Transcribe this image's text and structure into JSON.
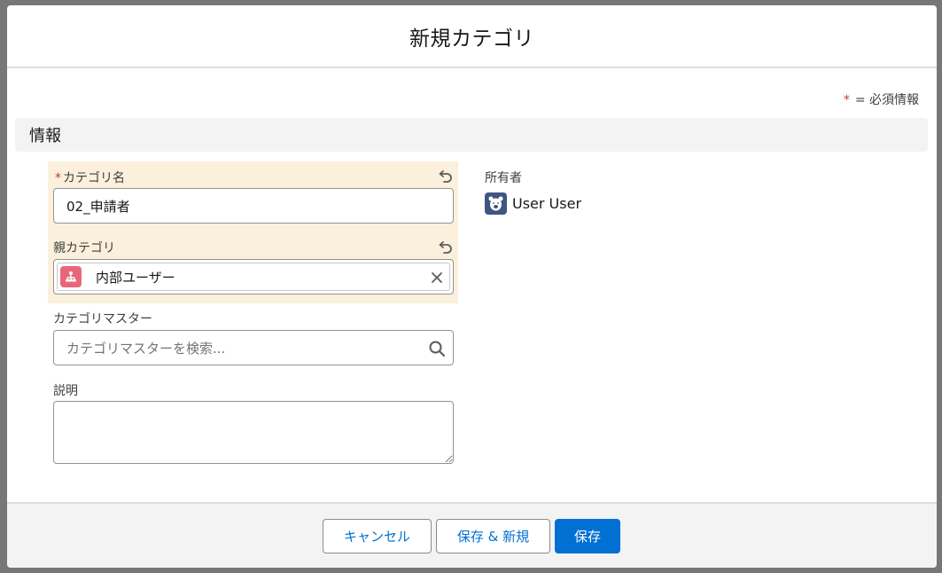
{
  "modal": {
    "title": "新規カテゴリ",
    "required_legend_star": "*",
    "required_legend_text": "= 必須情報"
  },
  "section": {
    "title": "情報"
  },
  "fields": {
    "category_name": {
      "required_mark": "*",
      "label": "カテゴリ名",
      "value": "02_申請者"
    },
    "parent_category": {
      "label": "親カテゴリ",
      "value": "内部ユーザー"
    },
    "category_master": {
      "label": "カテゴリマスター",
      "placeholder": "カテゴリマスターを検索..."
    },
    "description": {
      "label": "説明",
      "value": ""
    },
    "owner": {
      "label": "所有者",
      "value": "User User"
    }
  },
  "footer": {
    "cancel_label": "キャンセル",
    "save_new_label": "保存 & 新規",
    "save_label": "保存"
  },
  "colors": {
    "brand": "#0070d2",
    "edited_highlight": "#faf0dc",
    "required": "#c23934",
    "pill_icon": "#e8667a",
    "avatar": "#3e5681"
  },
  "icons": {
    "undo": "undo-icon",
    "clear": "close-icon",
    "search": "search-icon",
    "record": "category-record-icon",
    "avatar": "user-avatar-icon"
  }
}
